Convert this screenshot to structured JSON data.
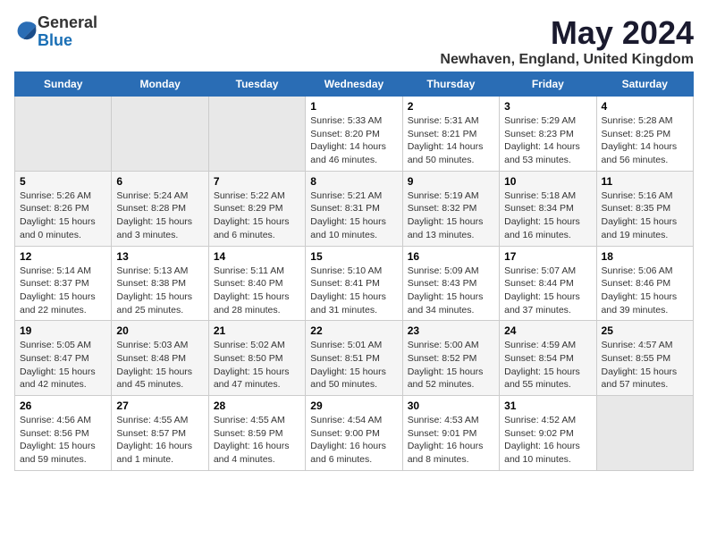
{
  "logo": {
    "general": "General",
    "blue": "Blue"
  },
  "title": "May 2024",
  "subtitle": "Newhaven, England, United Kingdom",
  "days_header": [
    "Sunday",
    "Monday",
    "Tuesday",
    "Wednesday",
    "Thursday",
    "Friday",
    "Saturday"
  ],
  "weeks": [
    [
      {
        "day": "",
        "info": ""
      },
      {
        "day": "",
        "info": ""
      },
      {
        "day": "",
        "info": ""
      },
      {
        "day": "1",
        "info": "Sunrise: 5:33 AM\nSunset: 8:20 PM\nDaylight: 14 hours\nand 46 minutes."
      },
      {
        "day": "2",
        "info": "Sunrise: 5:31 AM\nSunset: 8:21 PM\nDaylight: 14 hours\nand 50 minutes."
      },
      {
        "day": "3",
        "info": "Sunrise: 5:29 AM\nSunset: 8:23 PM\nDaylight: 14 hours\nand 53 minutes."
      },
      {
        "day": "4",
        "info": "Sunrise: 5:28 AM\nSunset: 8:25 PM\nDaylight: 14 hours\nand 56 minutes."
      }
    ],
    [
      {
        "day": "5",
        "info": "Sunrise: 5:26 AM\nSunset: 8:26 PM\nDaylight: 15 hours\nand 0 minutes."
      },
      {
        "day": "6",
        "info": "Sunrise: 5:24 AM\nSunset: 8:28 PM\nDaylight: 15 hours\nand 3 minutes."
      },
      {
        "day": "7",
        "info": "Sunrise: 5:22 AM\nSunset: 8:29 PM\nDaylight: 15 hours\nand 6 minutes."
      },
      {
        "day": "8",
        "info": "Sunrise: 5:21 AM\nSunset: 8:31 PM\nDaylight: 15 hours\nand 10 minutes."
      },
      {
        "day": "9",
        "info": "Sunrise: 5:19 AM\nSunset: 8:32 PM\nDaylight: 15 hours\nand 13 minutes."
      },
      {
        "day": "10",
        "info": "Sunrise: 5:18 AM\nSunset: 8:34 PM\nDaylight: 15 hours\nand 16 minutes."
      },
      {
        "day": "11",
        "info": "Sunrise: 5:16 AM\nSunset: 8:35 PM\nDaylight: 15 hours\nand 19 minutes."
      }
    ],
    [
      {
        "day": "12",
        "info": "Sunrise: 5:14 AM\nSunset: 8:37 PM\nDaylight: 15 hours\nand 22 minutes."
      },
      {
        "day": "13",
        "info": "Sunrise: 5:13 AM\nSunset: 8:38 PM\nDaylight: 15 hours\nand 25 minutes."
      },
      {
        "day": "14",
        "info": "Sunrise: 5:11 AM\nSunset: 8:40 PM\nDaylight: 15 hours\nand 28 minutes."
      },
      {
        "day": "15",
        "info": "Sunrise: 5:10 AM\nSunset: 8:41 PM\nDaylight: 15 hours\nand 31 minutes."
      },
      {
        "day": "16",
        "info": "Sunrise: 5:09 AM\nSunset: 8:43 PM\nDaylight: 15 hours\nand 34 minutes."
      },
      {
        "day": "17",
        "info": "Sunrise: 5:07 AM\nSunset: 8:44 PM\nDaylight: 15 hours\nand 37 minutes."
      },
      {
        "day": "18",
        "info": "Sunrise: 5:06 AM\nSunset: 8:46 PM\nDaylight: 15 hours\nand 39 minutes."
      }
    ],
    [
      {
        "day": "19",
        "info": "Sunrise: 5:05 AM\nSunset: 8:47 PM\nDaylight: 15 hours\nand 42 minutes."
      },
      {
        "day": "20",
        "info": "Sunrise: 5:03 AM\nSunset: 8:48 PM\nDaylight: 15 hours\nand 45 minutes."
      },
      {
        "day": "21",
        "info": "Sunrise: 5:02 AM\nSunset: 8:50 PM\nDaylight: 15 hours\nand 47 minutes."
      },
      {
        "day": "22",
        "info": "Sunrise: 5:01 AM\nSunset: 8:51 PM\nDaylight: 15 hours\nand 50 minutes."
      },
      {
        "day": "23",
        "info": "Sunrise: 5:00 AM\nSunset: 8:52 PM\nDaylight: 15 hours\nand 52 minutes."
      },
      {
        "day": "24",
        "info": "Sunrise: 4:59 AM\nSunset: 8:54 PM\nDaylight: 15 hours\nand 55 minutes."
      },
      {
        "day": "25",
        "info": "Sunrise: 4:57 AM\nSunset: 8:55 PM\nDaylight: 15 hours\nand 57 minutes."
      }
    ],
    [
      {
        "day": "26",
        "info": "Sunrise: 4:56 AM\nSunset: 8:56 PM\nDaylight: 15 hours\nand 59 minutes."
      },
      {
        "day": "27",
        "info": "Sunrise: 4:55 AM\nSunset: 8:57 PM\nDaylight: 16 hours\nand 1 minute."
      },
      {
        "day": "28",
        "info": "Sunrise: 4:55 AM\nSunset: 8:59 PM\nDaylight: 16 hours\nand 4 minutes."
      },
      {
        "day": "29",
        "info": "Sunrise: 4:54 AM\nSunset: 9:00 PM\nDaylight: 16 hours\nand 6 minutes."
      },
      {
        "day": "30",
        "info": "Sunrise: 4:53 AM\nSunset: 9:01 PM\nDaylight: 16 hours\nand 8 minutes."
      },
      {
        "day": "31",
        "info": "Sunrise: 4:52 AM\nSunset: 9:02 PM\nDaylight: 16 hours\nand 10 minutes."
      },
      {
        "day": "",
        "info": ""
      }
    ]
  ]
}
